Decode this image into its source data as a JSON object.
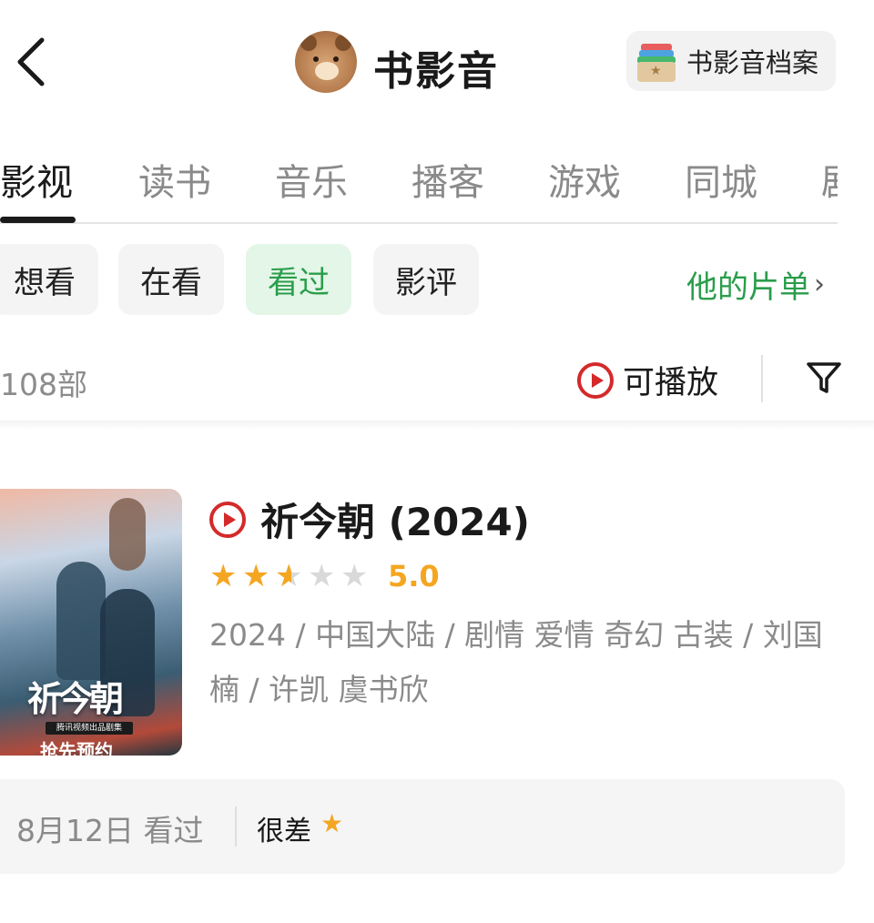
{
  "header": {
    "title": "书影音",
    "archive_label": "书影音档案"
  },
  "tabs": [
    "影视",
    "读书",
    "音乐",
    "播客",
    "游戏",
    "同城",
    "剧"
  ],
  "chips": [
    "想看",
    "在看",
    "看过",
    "影评"
  ],
  "active_chip": "看过",
  "list_link": {
    "label": "他的片单",
    "chevron": "›"
  },
  "count": "108部",
  "playable_label": "可播放",
  "item": {
    "title": "祈今朝 (2024)",
    "stars": 2.5,
    "rating": "5.0",
    "meta": "2024 / 中国大陆 / 剧情 爱情 奇幻 古装 / 刘国楠 / 许凯 虞书欣",
    "poster_title": "祈今朝",
    "poster_tag": "腾讯视频出品剧集",
    "poster_cta": "抢先预约"
  },
  "review": {
    "date": "8月12日 看过",
    "verdict": "很差",
    "stars": 1
  },
  "colors": {
    "accent_green": "#2a9d4b",
    "star_orange": "#f4a622",
    "play_red": "#d42a2a"
  },
  "icons": {
    "back": "back-chevron-icon",
    "filter": "filter-funnel-icon",
    "play": "play-circle-icon",
    "archive": "archive-box-icon",
    "star": "star-icon"
  }
}
